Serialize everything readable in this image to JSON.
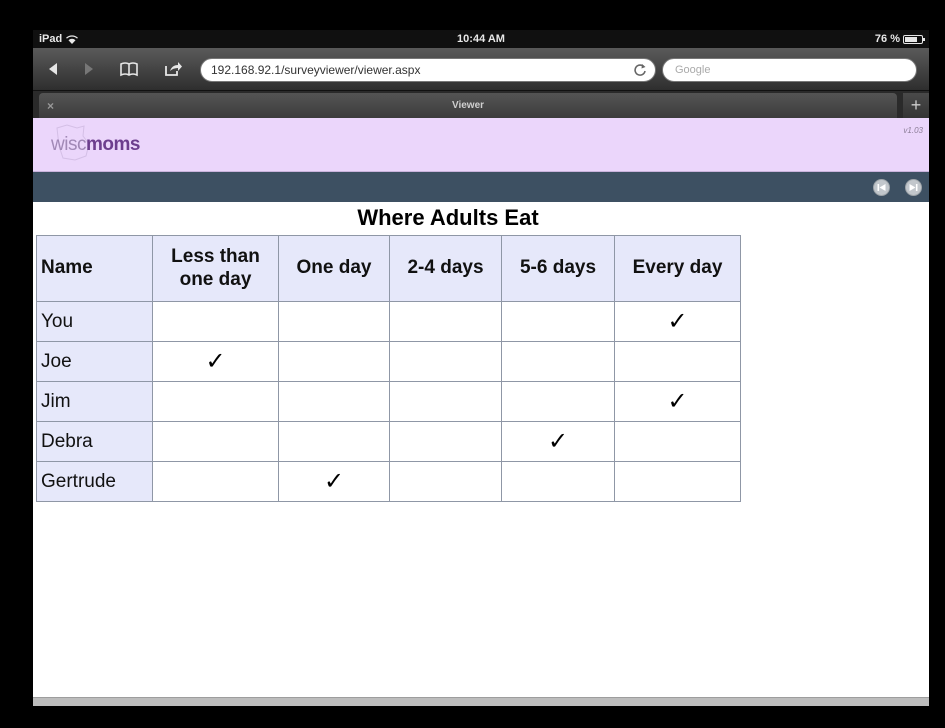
{
  "status_bar": {
    "device": "iPad",
    "time": "10:44 AM",
    "battery": "76 %",
    "battery_level": 0.76
  },
  "toolbar": {
    "url": "192.168.92.1/surveyviewer/viewer.aspx",
    "search_placeholder": "Google"
  },
  "tabs": {
    "close_label": "×",
    "active_title": "Viewer",
    "new_tab_label": "+"
  },
  "banner": {
    "logo_light": "wisc",
    "logo_bold": "moms",
    "version": "v1.03"
  },
  "content": {
    "title": "Where Adults Eat",
    "columns": [
      "Name",
      "Less than one day",
      "One day",
      "2-4 days",
      "5-6 days",
      "Every day"
    ],
    "check_symbol": "✓",
    "rows": [
      {
        "name": "You",
        "checked": 5
      },
      {
        "name": "Joe",
        "checked": 1
      },
      {
        "name": "Jim",
        "checked": 5
      },
      {
        "name": "Debra",
        "checked": 4
      },
      {
        "name": "Gertrude",
        "checked": 2
      }
    ]
  },
  "colors": {
    "banner_bg": "#ebd6fb",
    "nav_strip": "#3d5062",
    "header_cell": "#e6e8fa"
  }
}
